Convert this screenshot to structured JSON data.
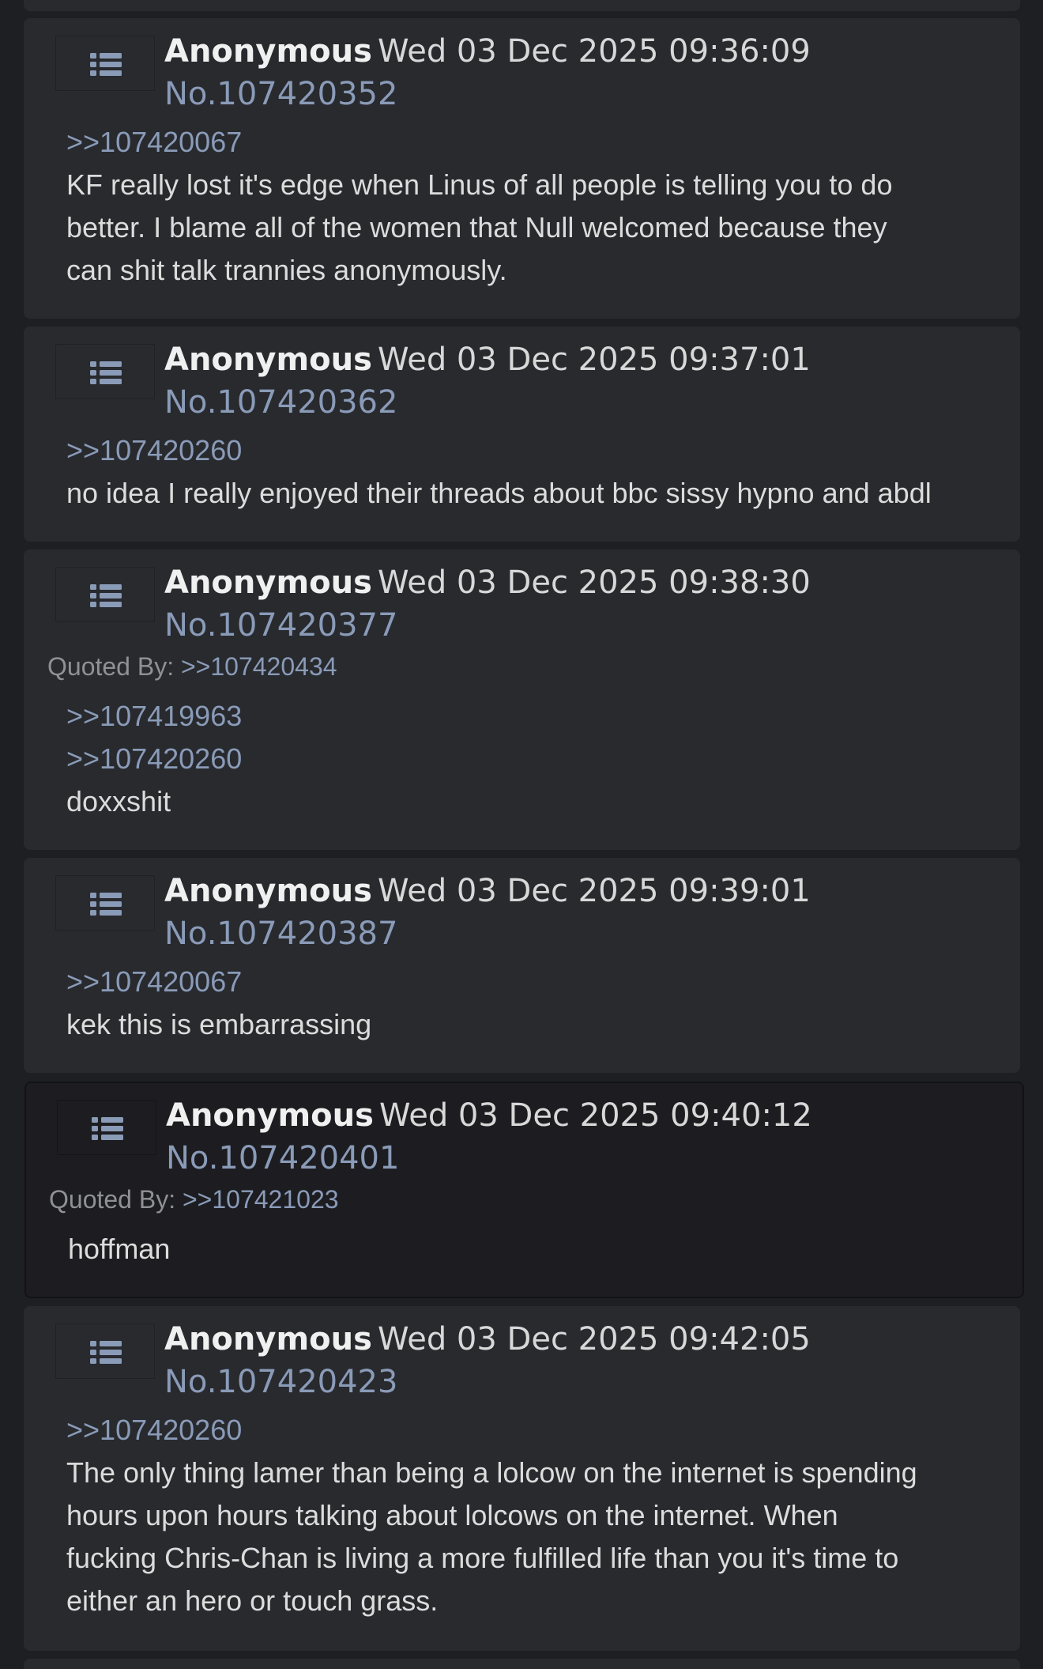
{
  "posts": [
    {
      "name": "Anonymous",
      "date": "Wed 03 Dec 2025 09:36:09",
      "no": "No.107420352",
      "quote_links": [
        ">>107420067"
      ],
      "text_lines": [
        "KF really lost it's edge when Linus of all people is telling you to do",
        "better. I blame all of the women that Null welcomed because they",
        "can shit talk trannies anonymously."
      ]
    },
    {
      "name": "Anonymous",
      "date": "Wed 03 Dec 2025 09:37:01",
      "no": "No.107420362",
      "quote_links": [
        ">>107420260"
      ],
      "text_lines": [
        "no idea I really enjoyed their threads about bbc sissy hypno and abdl"
      ]
    },
    {
      "name": "Anonymous",
      "date": "Wed 03 Dec 2025 09:38:30",
      "no": "No.107420377",
      "quoted_by_label": "Quoted By:",
      "quoted_by": ">>107420434",
      "quote_links": [
        ">>107419963",
        ">>107420260"
      ],
      "text_lines": [
        "doxxshit"
      ]
    },
    {
      "name": "Anonymous",
      "date": "Wed 03 Dec 2025 09:39:01",
      "no": "No.107420387",
      "quote_links": [
        ">>107420067"
      ],
      "text_lines": [
        "kek this is embarrassing"
      ]
    },
    {
      "name": "Anonymous",
      "date": "Wed 03 Dec 2025 09:40:12",
      "no": "No.107420401",
      "quoted_by_label": "Quoted By:",
      "quoted_by": ">>107421023",
      "quote_links": [],
      "text_lines": [
        "hoffman"
      ]
    },
    {
      "name": "Anonymous",
      "date": "Wed 03 Dec 2025 09:42:05",
      "no": "No.107420423",
      "quote_links": [
        ">>107420260"
      ],
      "text_lines": [
        "The only thing lamer than being a lolcow on the internet is spending",
        "hours upon hours talking about lolcows on the internet. When",
        "fucking Chris-Chan is living a more fulfilled life than you it's time to",
        "either an hero or touch grass."
      ]
    }
  ],
  "icons": {
    "post_menu": "list-icon"
  },
  "colors": {
    "background": "#1d1f22",
    "post_bg": "#282a2e",
    "highlight_bg": "#1d1d21",
    "name": "#f0f0f0",
    "link": "#8a9bb8",
    "text": "#dcdcdc"
  }
}
